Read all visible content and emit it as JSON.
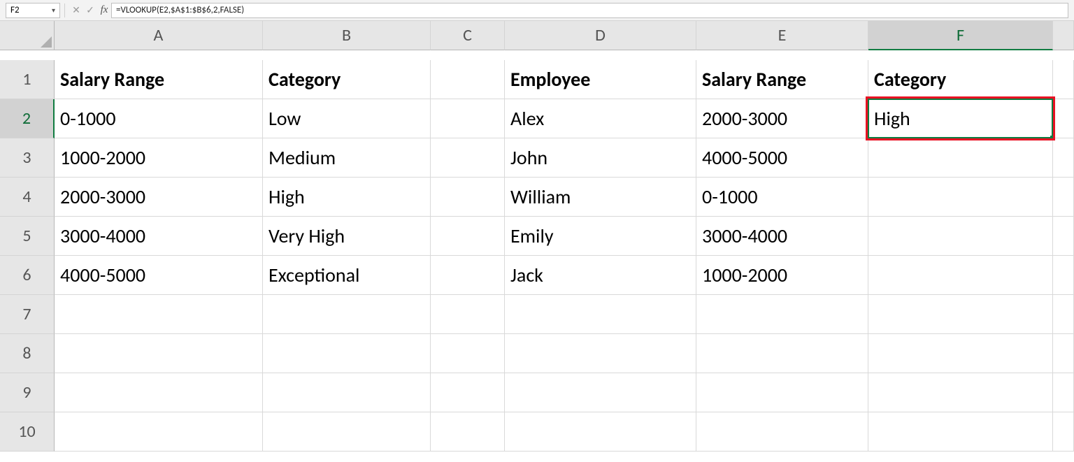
{
  "formula_bar": {
    "name_box_value": "F2",
    "cancel_label": "✕",
    "enter_label": "✓",
    "fx_label": "fx",
    "formula": "=VLOOKUP(E2,$A$1:$B$6,2,FALSE)"
  },
  "columns": [
    "A",
    "B",
    "C",
    "D",
    "E",
    "F"
  ],
  "rows": [
    "1",
    "2",
    "3",
    "4",
    "5",
    "6",
    "7",
    "8",
    "9",
    "10"
  ],
  "active_cell": "F2",
  "selected_column_index": 5,
  "selected_row_index": 1,
  "highlight_cell": "F2",
  "cells": {
    "A1": "Salary Range",
    "B1": "Category",
    "D1": "Employee",
    "E1": "Salary Range",
    "F1": "Category",
    "A2": "0-1000",
    "B2": "Low",
    "D2": "Alex",
    "E2": "2000-3000",
    "F2": "High",
    "A3": "1000-2000",
    "B3": "Medium",
    "D3": "John",
    "E3": "4000-5000",
    "A4": "2000-3000",
    "B4": "High",
    "D4": "William",
    "E4": "0-1000",
    "A5": "3000-4000",
    "B5": "Very High",
    "D5": "Emily",
    "E5": "3000-4000",
    "A6": "4000-5000",
    "B6": "Exceptional",
    "D6": "Jack",
    "E6": "1000-2000"
  }
}
